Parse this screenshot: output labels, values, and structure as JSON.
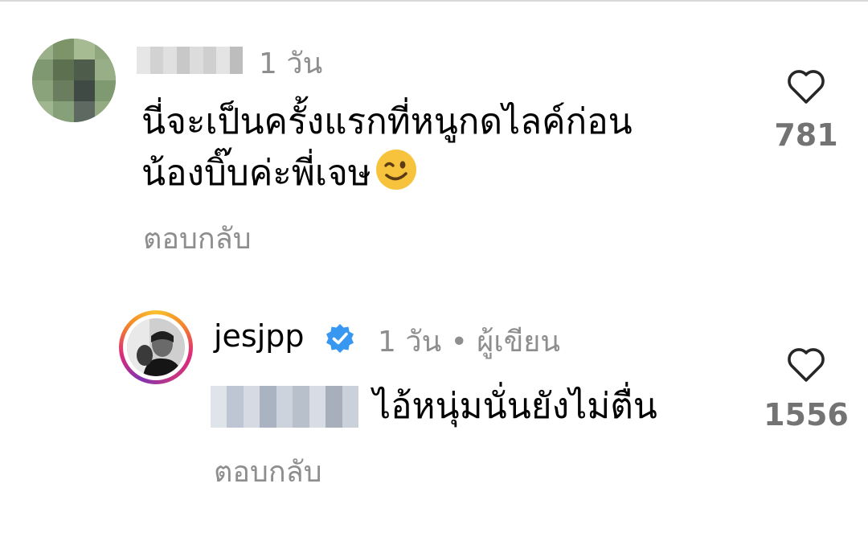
{
  "comments": [
    {
      "username": "",
      "time": "1 วัน",
      "text_line1": "นี่จะเป็นครั้งแรกที่หนูกดไลค์ก่อน",
      "text_line2": "น้องบิ๊บค่ะพี่เจษ",
      "emoji_icon": "winking-face-icon",
      "reply_label": "ตอบกลับ",
      "like_count": "781",
      "heart_icon": "heart-outline-icon"
    },
    {
      "username": "jesjpp",
      "verified_icon": "verified-badge-icon",
      "meta": "1 วัน • ผู้เขียน",
      "text": "ไอ้หนุ่มนั่นยังไม่ตื่น",
      "reply_label": "ตอบกลับ",
      "like_count": "1556",
      "heart_icon": "heart-outline-icon"
    }
  ],
  "colors": {
    "secondary_text": "#8e8e8e",
    "like_count": "#737373",
    "verified_blue": "#3897f0"
  }
}
